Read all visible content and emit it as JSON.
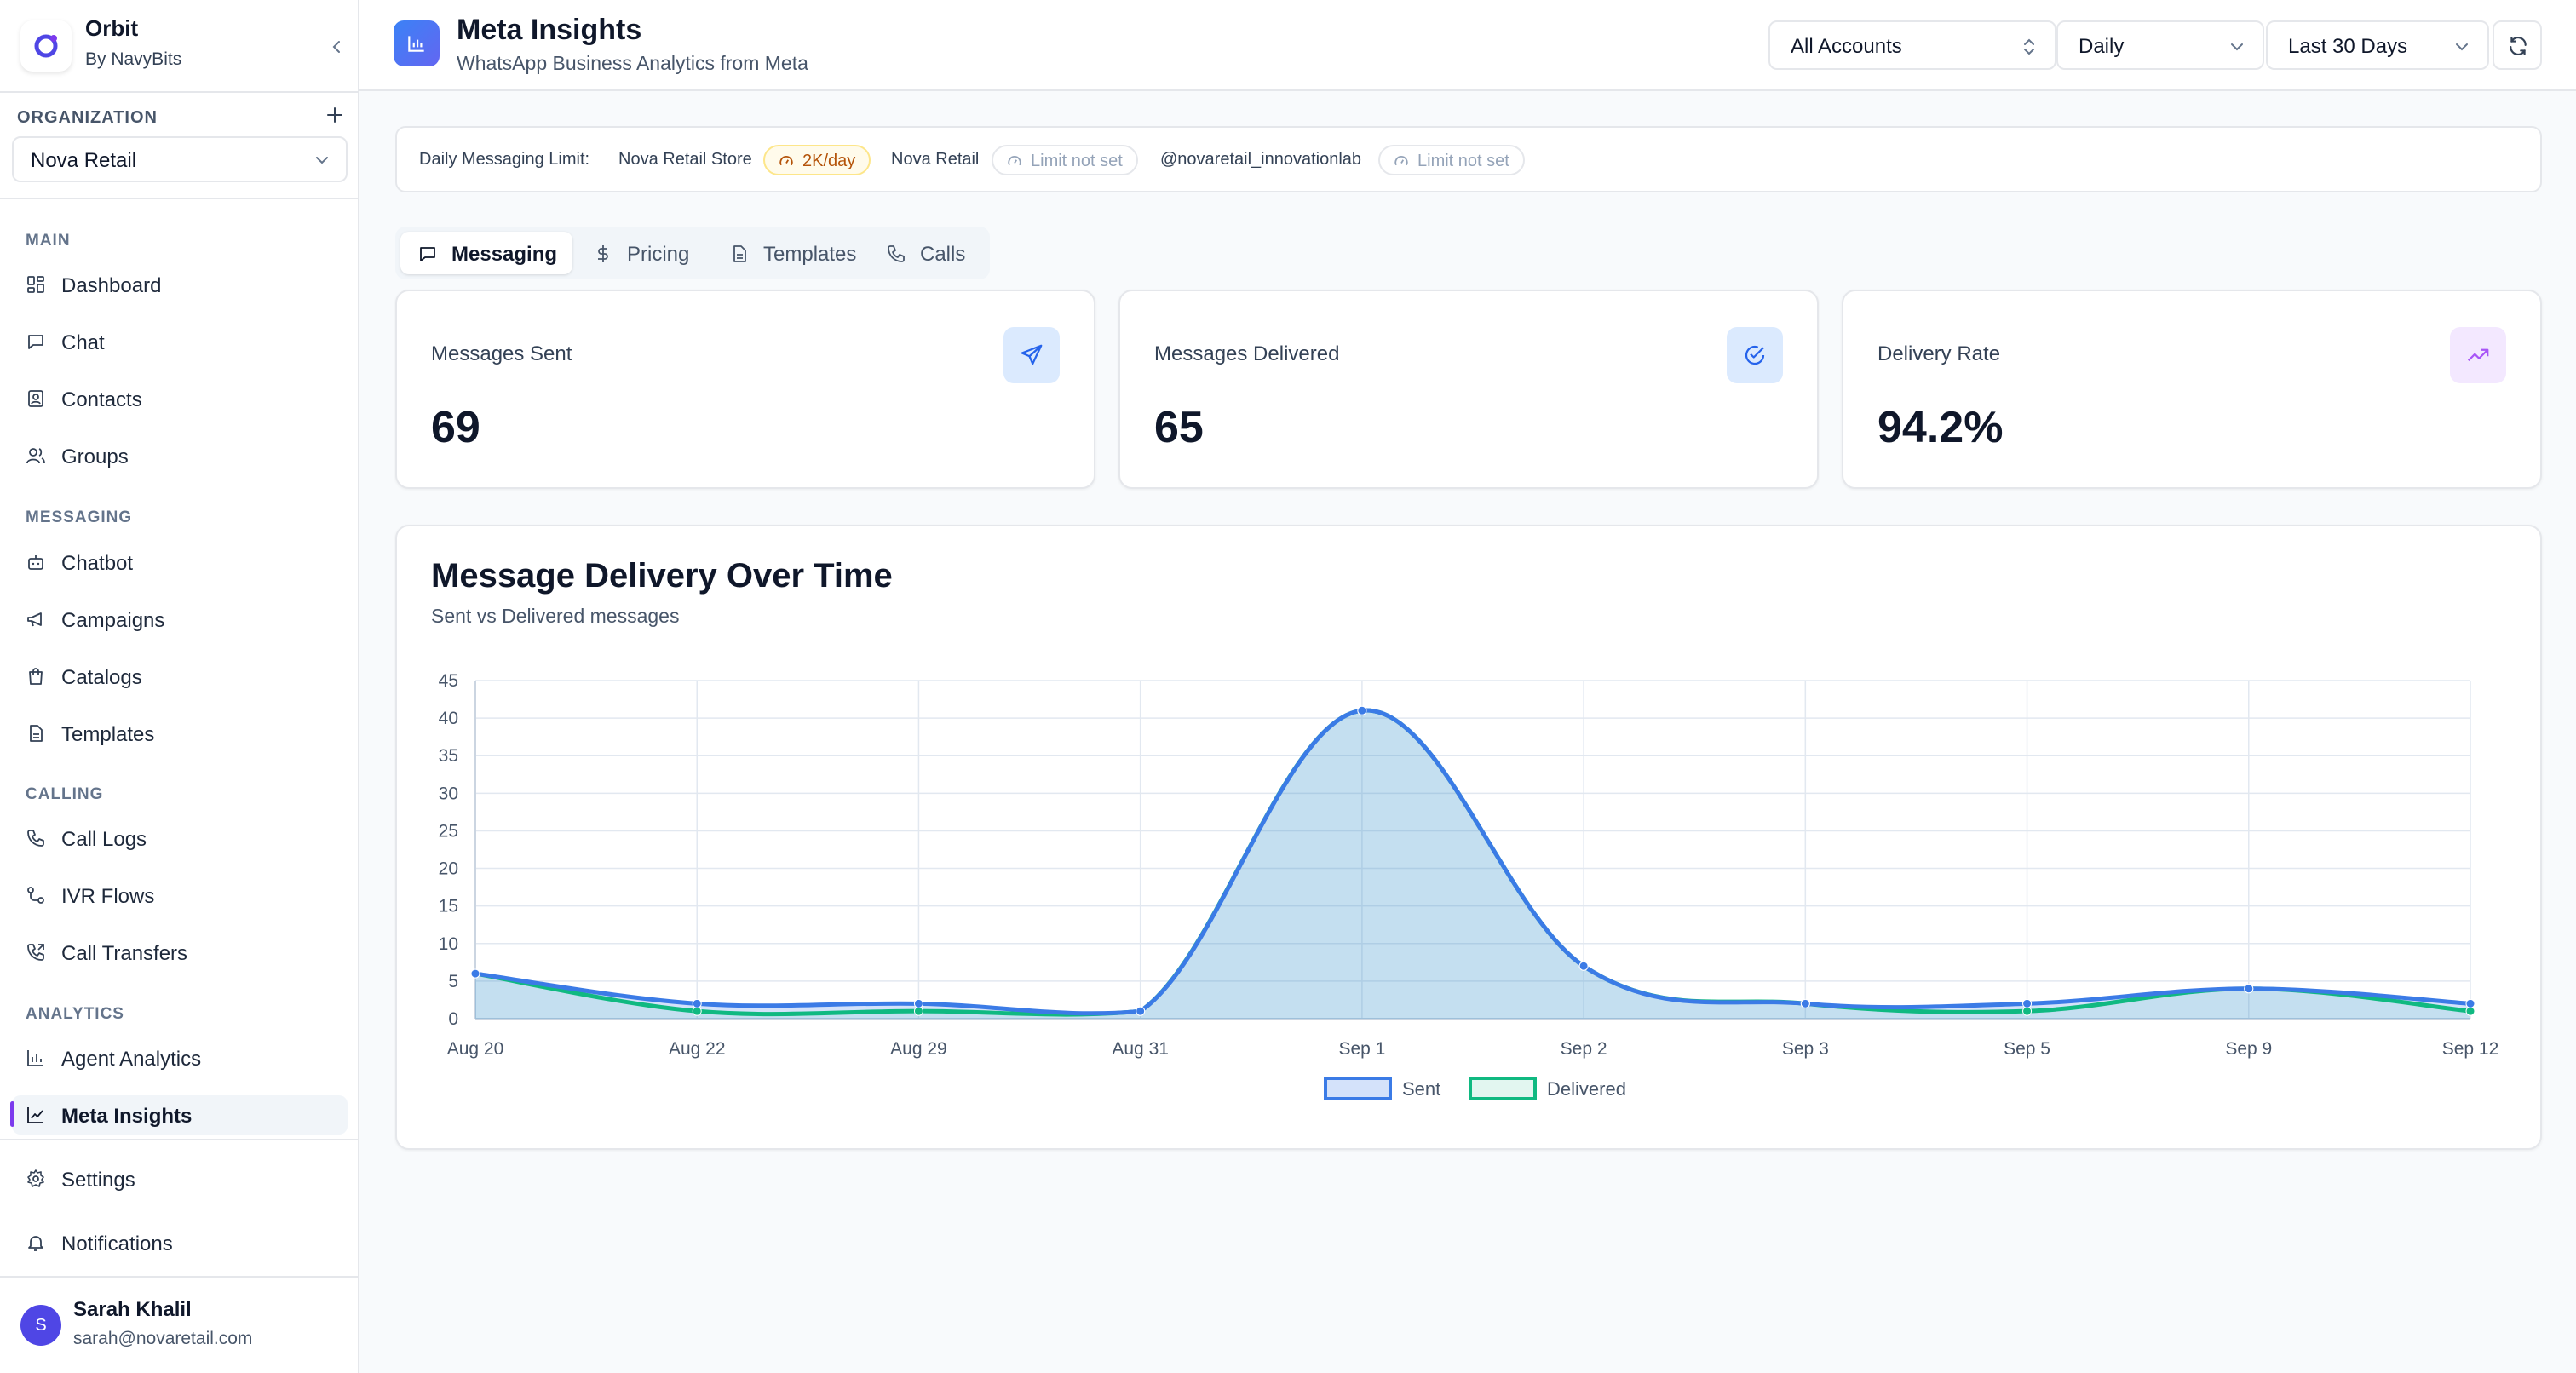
{
  "brand": {
    "name": "Orbit",
    "sub": "By NavyBits"
  },
  "org": {
    "label": "ORGANIZATION",
    "selected": "Nova Retail"
  },
  "nav": {
    "sections": [
      {
        "label": "MAIN"
      },
      {
        "label": "MESSAGING"
      },
      {
        "label": "CALLING"
      },
      {
        "label": "ANALYTICS"
      }
    ],
    "items": [
      {
        "label": "Dashboard",
        "icon": "dashboard-icon"
      },
      {
        "label": "Chat",
        "icon": "chat-icon"
      },
      {
        "label": "Contacts",
        "icon": "contacts-icon"
      },
      {
        "label": "Groups",
        "icon": "groups-icon"
      },
      {
        "label": "Chatbot",
        "icon": "chatbot-icon"
      },
      {
        "label": "Campaigns",
        "icon": "megaphone-icon"
      },
      {
        "label": "Catalogs",
        "icon": "catalog-icon"
      },
      {
        "label": "Templates",
        "icon": "document-icon"
      },
      {
        "label": "Call Logs",
        "icon": "phone-icon"
      },
      {
        "label": "IVR Flows",
        "icon": "flow-icon"
      },
      {
        "label": "Call Transfers",
        "icon": "phone-forward-icon"
      },
      {
        "label": "Agent Analytics",
        "icon": "bar-chart-icon"
      },
      {
        "label": "Meta Insights",
        "icon": "line-chart-icon"
      }
    ],
    "bottom": [
      {
        "label": "Settings",
        "icon": "gear-icon"
      },
      {
        "label": "Notifications",
        "icon": "bell-icon"
      }
    ]
  },
  "user": {
    "initial": "S",
    "name": "Sarah Khalil",
    "email": "sarah@novaretail.com"
  },
  "header": {
    "title": "Meta Insights",
    "subtitle": "WhatsApp Business Analytics from Meta",
    "account_select": "All Accounts",
    "granularity_select": "Daily",
    "range_select": "Last 30 Days"
  },
  "limits": {
    "label": "Daily Messaging Limit:",
    "accounts": [
      {
        "name": "Nova Retail Store",
        "value": "2K/day"
      },
      {
        "name": "Nova Retail",
        "value": "Limit not set"
      },
      {
        "name": "@novaretail_innovationlab",
        "value": "Limit not set"
      }
    ]
  },
  "tabs": [
    "Messaging",
    "Pricing",
    "Templates",
    "Calls"
  ],
  "stats": [
    {
      "label": "Messages Sent",
      "value": "69",
      "icon": "send-icon",
      "bg": "#dbeafe",
      "fg": "#2563eb"
    },
    {
      "label": "Messages Delivered",
      "value": "65",
      "icon": "check-circle-icon",
      "bg": "#dbeafe",
      "fg": "#2563eb"
    },
    {
      "label": "Delivery Rate",
      "value": "94.2%",
      "icon": "trending-up-icon",
      "bg": "#f3e8ff",
      "fg": "#a855f7"
    }
  ],
  "chart_data": {
    "type": "area",
    "title": "Message Delivery Over Time",
    "subtitle": "Sent vs Delivered messages",
    "categories": [
      "Aug 20",
      "Aug 22",
      "Aug 29",
      "Aug 31",
      "Sep 1",
      "Sep 2",
      "Sep 3",
      "Sep 5",
      "Sep 9",
      "Sep 12"
    ],
    "ylim": [
      0,
      45
    ],
    "yticks": [
      0,
      5,
      10,
      15,
      20,
      25,
      30,
      35,
      40,
      45
    ],
    "series": [
      {
        "name": "Sent",
        "values": [
          6,
          2,
          2,
          1,
          41,
          7,
          2,
          2,
          4,
          2
        ],
        "color": "#3b7be6"
      },
      {
        "name": "Delivered",
        "values": [
          6,
          1,
          1,
          1,
          41,
          7,
          2,
          1,
          4,
          1
        ],
        "color": "#10b981"
      }
    ],
    "grid": true,
    "legend": "bottom"
  }
}
